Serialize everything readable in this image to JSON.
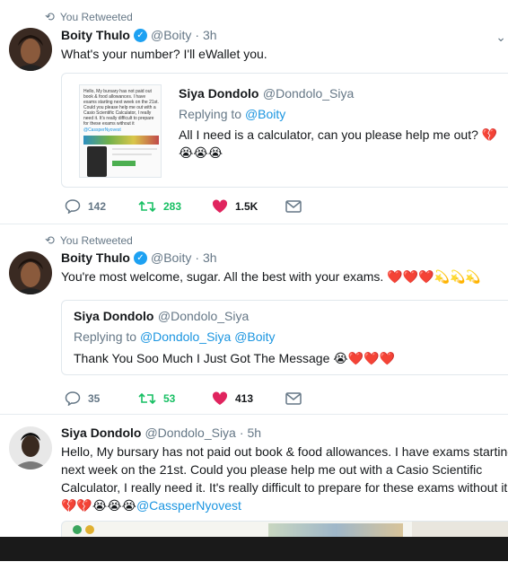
{
  "tweets": [
    {
      "retweet_label": "You Retweeted",
      "author": "Boity Thulo",
      "handle": "@Boity",
      "dot": "·",
      "time": "3h",
      "text": "What's your number? I'll eWallet you.",
      "quote": {
        "author": "Siya Dondolo",
        "handle": "@Dondolo_Siya",
        "replying_prefix": "Replying to ",
        "replying_to": "@Boity",
        "text": "All I need is a calculator, can you please help me out? 💔",
        "emoji_line": "😭😭😭",
        "thumb_text": "Hello, My bursary has not paid out book & food allowances. I have exams starting next week on the 21st. Could you please help me out with a Casio Scientific Calculator, I really need it. It's really difficult to prepare for these exams without it",
        "thumb_mention": "@CassperNyovest"
      },
      "reply_count": "142",
      "retweet_count": "283",
      "like_count": "1.5K"
    },
    {
      "retweet_label": "You Retweeted",
      "author": "Boity Thulo",
      "handle": "@Boity",
      "dot": "·",
      "time": "3h",
      "text": "You're most welcome, sugar. All the best with your exams. ❤️❤️❤️💫💫💫",
      "quote": {
        "author": "Siya Dondolo",
        "handle": "@Dondolo_Siya",
        "replying_prefix": "Replying to ",
        "replying_to": "@Dondolo_Siya @Boity",
        "text": "Thank You Soo Much I Just Got The Message 😭❤️❤️❤️"
      },
      "reply_count": "35",
      "retweet_count": "53",
      "like_count": "413"
    },
    {
      "author": "Siya Dondolo",
      "handle": "@Dondolo_Siya",
      "dot": "·",
      "time": "5h",
      "line1": "Hello, My bursary has not paid out book & food allowances. I have exams starting",
      "line2": "next week on the 21st. Could you please help me out with a Casio Scientific",
      "line3": "Calculator, I really need it. It's really difficult to prepare for these exams without it",
      "line4_emoji": "💔💔😭😭😭",
      "line4_mention": "@CassperNyovest"
    }
  ],
  "colors": {
    "accent": "#1da1f2",
    "retweet_green": "#17bf63",
    "like_red": "#e0245e",
    "muted": "#657786"
  }
}
